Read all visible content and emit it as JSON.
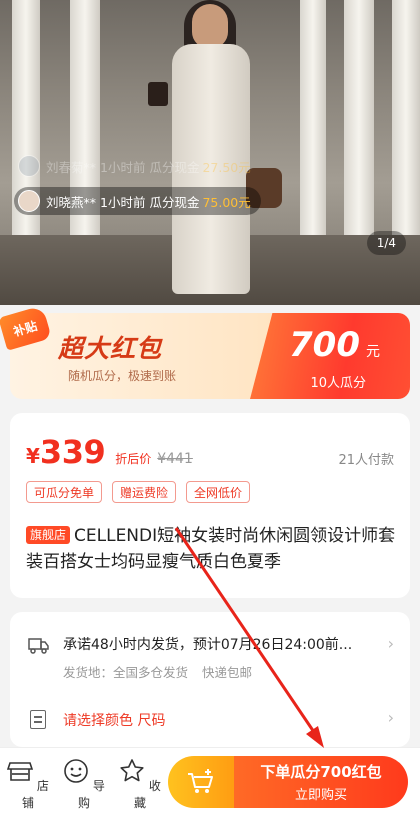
{
  "hero": {
    "barrage": [
      {
        "name": "刘春菊**",
        "time": "1小时前",
        "action": "瓜分现金",
        "amount": "27.50元"
      },
      {
        "name": "刘晓燕**",
        "time": "1小时前",
        "action": "瓜分现金",
        "amount": "75.00元"
      }
    ],
    "image_counter": "1/4"
  },
  "promo": {
    "subsidy_tag": "补贴",
    "title": "超大红包",
    "subtitle": "随机瓜分，极速到账",
    "amount": "700",
    "unit": "元",
    "people": "10人瓜分"
  },
  "product": {
    "currency": "¥",
    "price": "339",
    "price_after_label": "折后价",
    "original_price": "¥441",
    "paid_count": "21人付款",
    "tags": [
      "可瓜分免单",
      "赠运费险",
      "全网低价"
    ],
    "shop_badge": "旗舰店",
    "title": "CELLENDI短袖女装时尚休闲圆领设计师套装百搭女士均码显瘦气质白色夏季"
  },
  "shipping": {
    "promise": "承诺48小时内发货，预计07月26日24:00前...",
    "origin": "发货地：全国多仓发货",
    "free_shipping": "快递包邮",
    "spec_prompt": "请选择颜色 尺码"
  },
  "bottom_bar": {
    "nav": [
      {
        "label": "店铺",
        "icon": "store-icon"
      },
      {
        "label": "导购",
        "icon": "customer-service-icon"
      },
      {
        "label": "收藏",
        "icon": "star-icon"
      }
    ],
    "cart_icon": "cart-icon",
    "buy_main": "下单瓜分700红包",
    "buy_sub": "立即购买"
  },
  "colors": {
    "accent_red": "#f1301f",
    "buy_gradient_end": "#ff3a1c",
    "cart_yellow": "#ffc21f"
  }
}
